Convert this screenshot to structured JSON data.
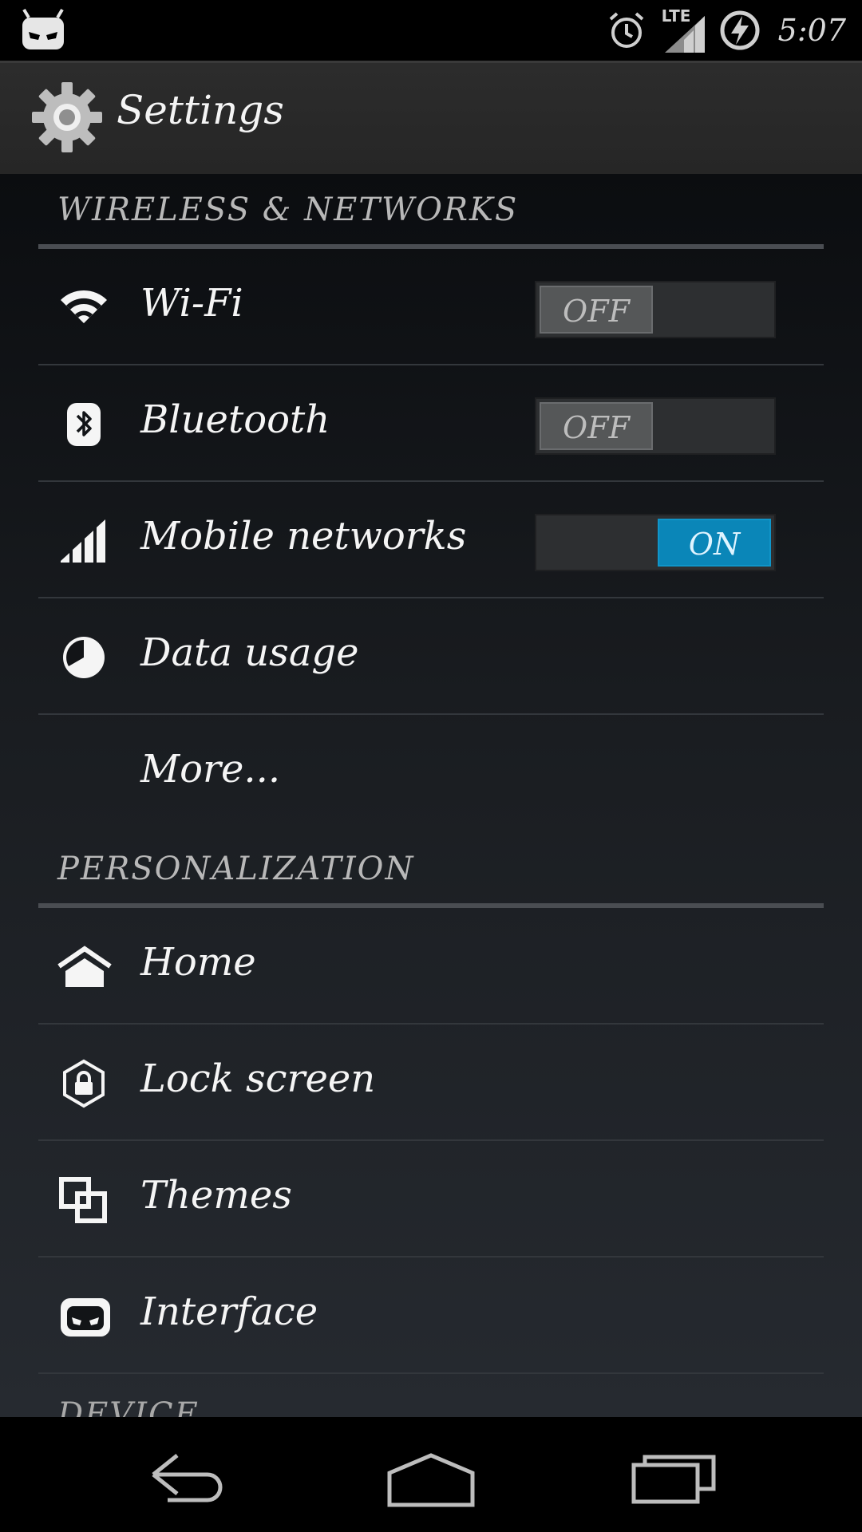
{
  "status_bar": {
    "time": "5:07",
    "network_label": "LTE",
    "icons": [
      "cyanogenmod-icon",
      "alarm-icon",
      "lte-signal-icon",
      "battery-charging-icon"
    ]
  },
  "action_bar": {
    "title": "Settings",
    "icon": "settings-gear-icon"
  },
  "sections": [
    {
      "header": "WIRELESS & NETWORKS",
      "items": [
        {
          "label": "Wi-Fi",
          "icon": "wifi-icon",
          "toggle": "OFF"
        },
        {
          "label": "Bluetooth",
          "icon": "bluetooth-icon",
          "toggle": "OFF"
        },
        {
          "label": "Mobile networks",
          "icon": "signal-bars-icon",
          "toggle": "ON"
        },
        {
          "label": "Data usage",
          "icon": "data-usage-icon"
        },
        {
          "label": "More..."
        }
      ]
    },
    {
      "header": "PERSONALIZATION",
      "items": [
        {
          "label": "Home",
          "icon": "home-icon"
        },
        {
          "label": "Lock screen",
          "icon": "lock-icon"
        },
        {
          "label": "Themes",
          "icon": "themes-icon"
        },
        {
          "label": "Interface",
          "icon": "interface-icon"
        }
      ]
    },
    {
      "header": "DEVICE"
    }
  ],
  "nav_bar": {
    "buttons": [
      "back-icon",
      "home-nav-icon",
      "recents-icon"
    ]
  },
  "colors": {
    "accent_on": "#0a86b8",
    "toggle_off": "#555758",
    "background_top": "#0b0d10",
    "background_bottom": "#262a30"
  }
}
